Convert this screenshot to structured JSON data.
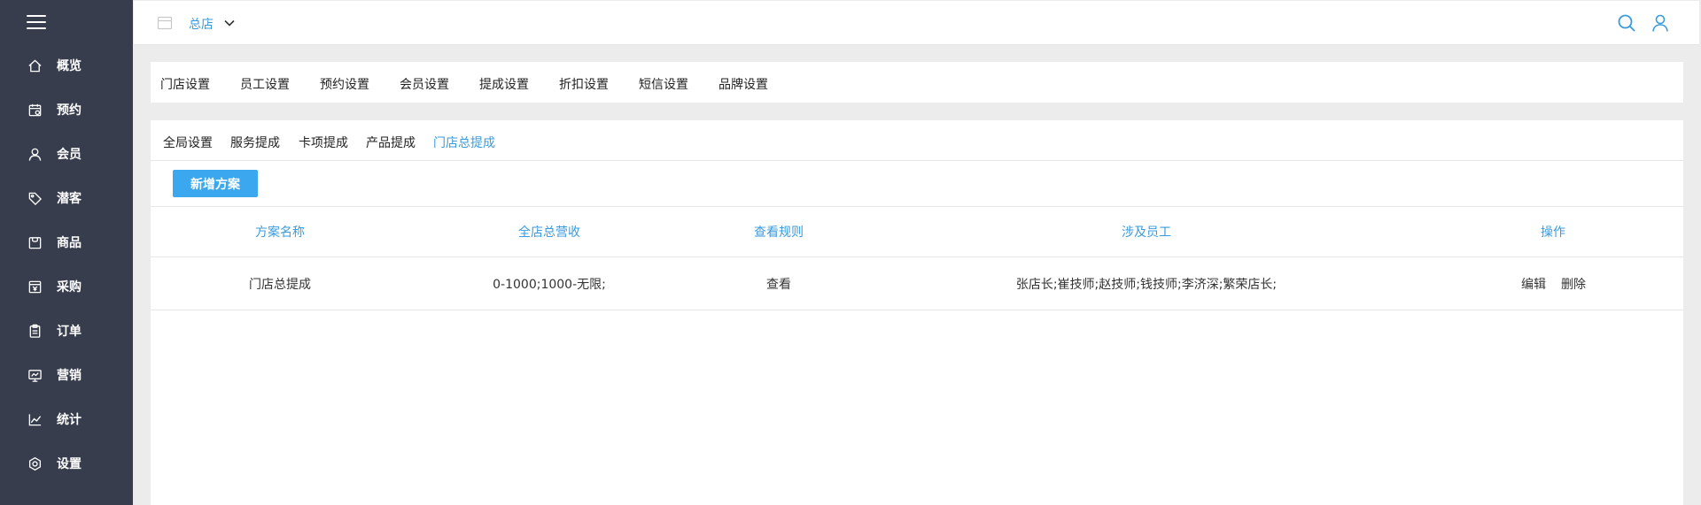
{
  "sidebar": {
    "items": [
      {
        "label": "概览",
        "icon": "home-icon"
      },
      {
        "label": "预约",
        "icon": "calendar-icon"
      },
      {
        "label": "会员",
        "icon": "user-icon"
      },
      {
        "label": "潜客",
        "icon": "tag-icon"
      },
      {
        "label": "商品",
        "icon": "bag-icon"
      },
      {
        "label": "采购",
        "icon": "purchase-icon"
      },
      {
        "label": "订单",
        "icon": "clipboard-icon"
      },
      {
        "label": "营销",
        "icon": "marketing-icon"
      },
      {
        "label": "统计",
        "icon": "chart-icon"
      },
      {
        "label": "设置",
        "icon": "gear-icon"
      }
    ]
  },
  "topbar": {
    "store_name": "总店"
  },
  "settings_tabs": [
    "门店设置",
    "员工设置",
    "预约设置",
    "会员设置",
    "提成设置",
    "折扣设置",
    "短信设置",
    "品牌设置"
  ],
  "commission_tabs": [
    "全局设置",
    "服务提成",
    "卡项提成",
    "产品提成",
    "门店总提成"
  ],
  "active_commission_tab": "门店总提成",
  "add_button_label": "新增方案",
  "table": {
    "headers": [
      "方案名称",
      "全店总营收",
      "查看规则",
      "涉及员工",
      "操作"
    ],
    "rows": [
      {
        "name": "门店总提成",
        "revenue": "0-1000;1000-无限;",
        "view": "查看",
        "employees": "张店长;崔技师;赵技师;钱技师;李济深;繁荣店长;",
        "edit": "编辑",
        "delete": "删除"
      }
    ]
  },
  "colors": {
    "sidebar_bg": "#373d4d",
    "accent": "#3a9bdc",
    "button": "#3aa7ef"
  }
}
